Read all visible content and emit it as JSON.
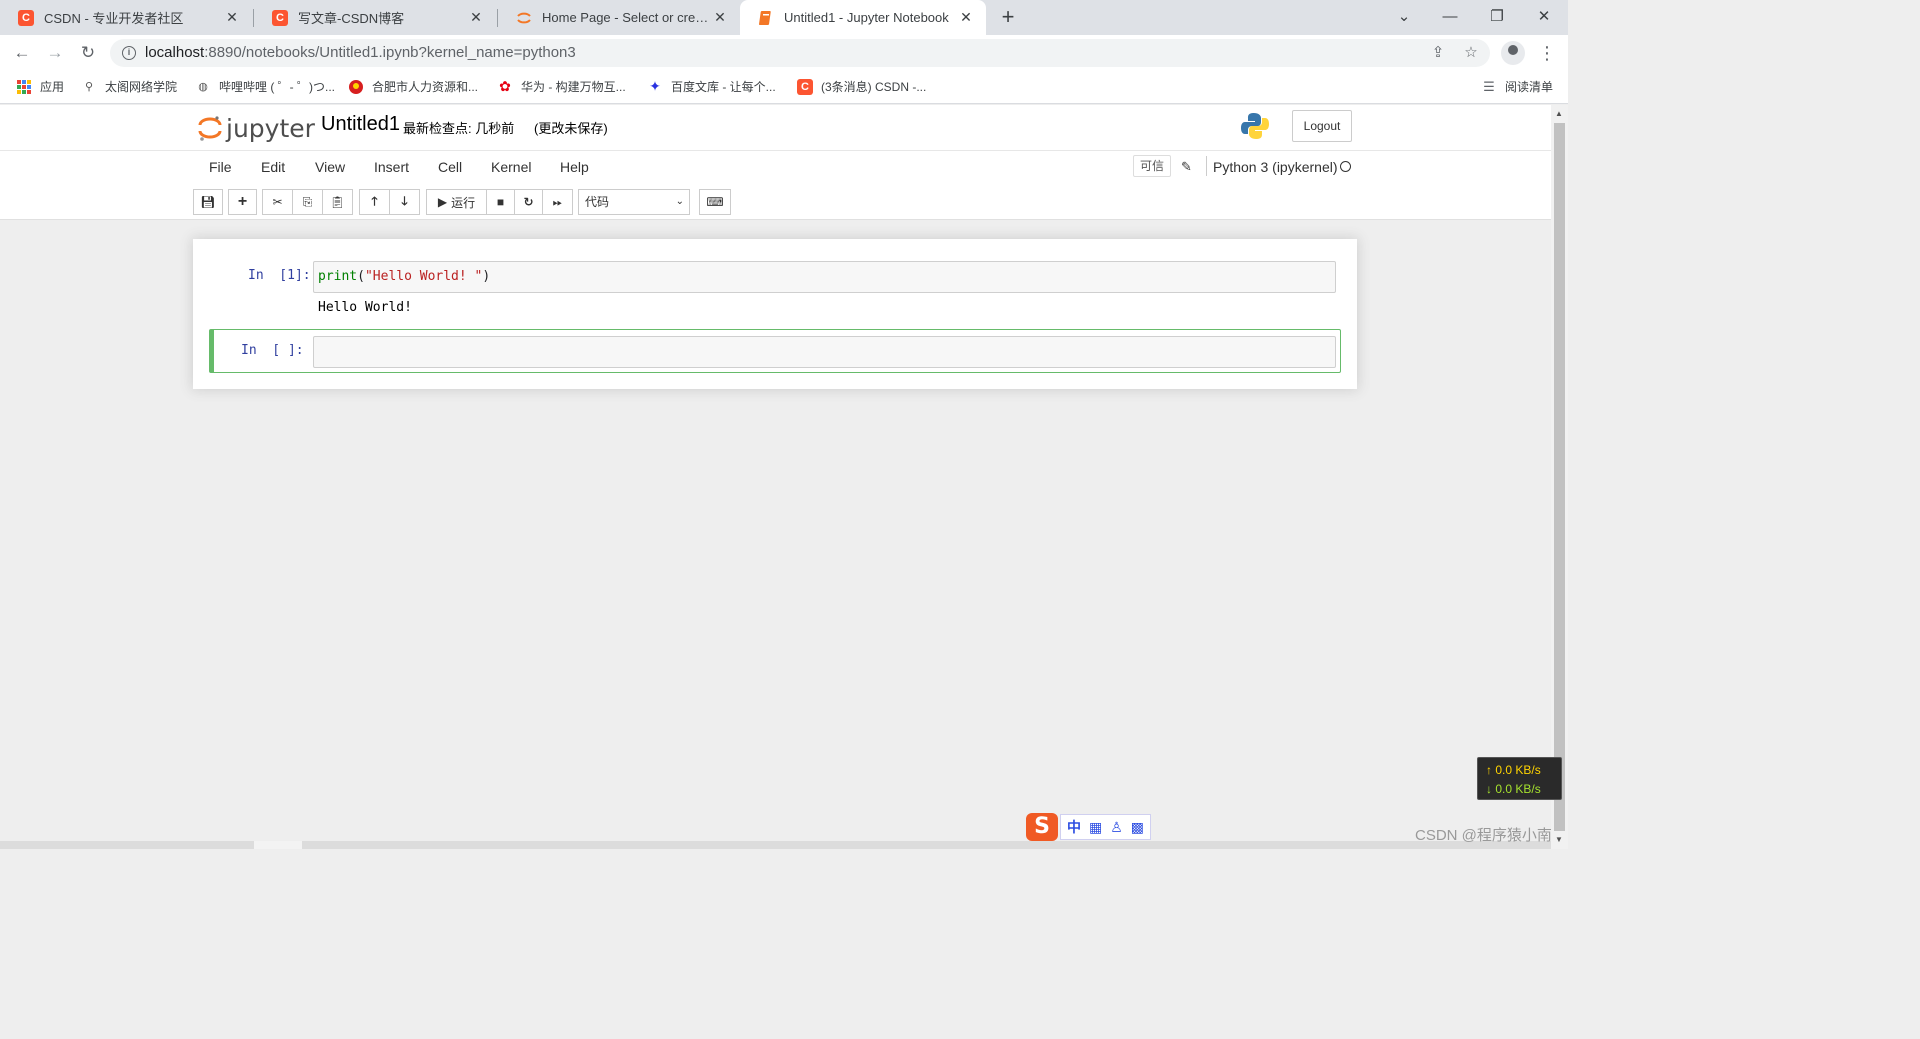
{
  "browser": {
    "tabs": [
      {
        "title": "CSDN - 专业开发者社区",
        "icon": "csdn-icon"
      },
      {
        "title": "写文章-CSDN博客",
        "icon": "csdn-icon"
      },
      {
        "title": "Home Page - Select or create a notebook",
        "icon": "jupyter-icon"
      },
      {
        "title": "Untitled1 - Jupyter Notebook",
        "icon": "notebook-icon",
        "active": true
      }
    ],
    "url_host": "localhost",
    "url_rest": ":8890/notebooks/Untitled1.ipynb?kernel_name=python3",
    "bookmarks": [
      {
        "label": "应用",
        "icon": "apps-grid-icon"
      },
      {
        "label": "太阁网络学院",
        "icon": "taige-icon"
      },
      {
        "label": "哔哩哔哩 ( ゜- ゜)つ...",
        "icon": "bilibili-icon"
      },
      {
        "label": "合肥市人力资源和...",
        "icon": "emblem-icon"
      },
      {
        "label": "华为 - 构建万物互...",
        "icon": "huawei-icon"
      },
      {
        "label": "百度文库 - 让每个...",
        "icon": "baidu-icon"
      },
      {
        "label": "(3条消息) CSDN -...",
        "icon": "csdn-icon"
      }
    ],
    "reading_list": "阅读清单"
  },
  "jupyter": {
    "logo_text": "jupyter",
    "notebook_name": "Untitled1",
    "checkpoint": "最新检查点: 几秒前",
    "autosave": "(更改未保存)",
    "logout": "Logout",
    "menu": [
      "File",
      "Edit",
      "View",
      "Insert",
      "Cell",
      "Kernel",
      "Help"
    ],
    "trusted": "可信",
    "kernel": "Python 3 (ipykernel)",
    "run_label": "运行",
    "cell_type": "代码",
    "cells": [
      {
        "prompt": "In  [1]:",
        "code_fn": "print",
        "code_open": "(",
        "code_str": "\"Hello World! \"",
        "code_close": ")",
        "output": "Hello World!"
      },
      {
        "prompt": "In  [ ]:",
        "code": ""
      }
    ]
  },
  "overlay": {
    "net_up": "↑ 0.0 KB/s",
    "net_down": "↓ 0.0 KB/s",
    "ime_lang": "中",
    "watermark": "CSDN @程序猿小南"
  },
  "colors": {
    "csdn": "#fc5531",
    "jupyter_orange": "#f37726",
    "selected_cell": "#66bb6a",
    "prompt": "#303f9f"
  }
}
